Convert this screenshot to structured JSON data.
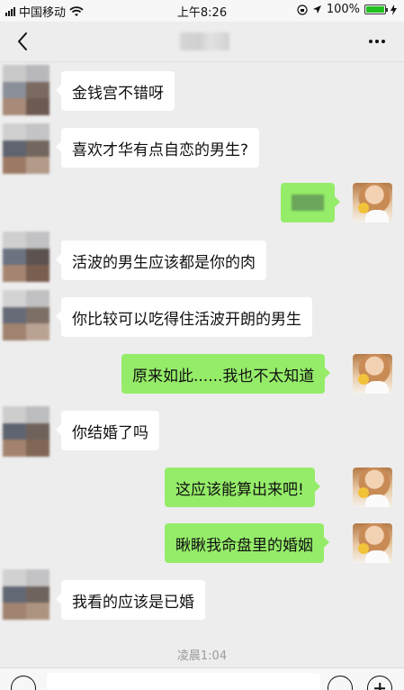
{
  "status_bar": {
    "carrier": "中国移动",
    "time": "上午8:26",
    "battery": "100%",
    "battery_level": 1.0,
    "icons": [
      "signal-icon",
      "wifi-icon",
      "lock-rotation-icon",
      "location-icon",
      "battery-icon",
      "charging-icon"
    ]
  },
  "nav": {
    "back_icon": "chevron-left-icon",
    "more_icon": "more-dots-icon"
  },
  "messages": [
    {
      "side": "in",
      "text": "金钱宫不错呀"
    },
    {
      "side": "in",
      "text": "喜欢才华有点自恋的男生?"
    },
    {
      "side": "out",
      "text": ""
    },
    {
      "side": "in",
      "text": "活波的男生应该都是你的肉"
    },
    {
      "side": "in",
      "text": "你比较可以吃得住活波开朗的男生"
    },
    {
      "side": "out",
      "text": "原来如此......我也不太知道"
    },
    {
      "side": "in",
      "text": "你结婚了吗"
    },
    {
      "side": "out",
      "text": "这应该能算出来吧!"
    },
    {
      "side": "out",
      "text": "瞅瞅我命盘里的婚姻"
    },
    {
      "side": "in",
      "text": "我看的应该是已婚"
    }
  ],
  "timestamp": "凌晨1:04",
  "colors": {
    "background": "#ededed",
    "bubble_out": "#95ec69",
    "bubble_in": "#ffffff",
    "timestamp": "#9b9b9b"
  },
  "input_bar": {
    "icons": [
      "voice-icon",
      "emoji-icon",
      "plus-icon"
    ]
  }
}
